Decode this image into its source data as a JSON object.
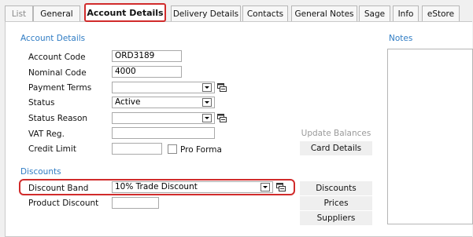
{
  "tabs": [
    "List",
    "General",
    "Account Details",
    "Delivery Details",
    "Contacts",
    "General Notes",
    "Sage",
    "Info",
    "eStore"
  ],
  "account_details": {
    "heading": "Account Details",
    "account_code_label": "Account Code",
    "account_code_value": "ORD3189",
    "nominal_code_label": "Nominal Code",
    "nominal_code_value": "4000",
    "payment_terms_label": "Payment Terms",
    "payment_terms_value": "",
    "status_label": "Status",
    "status_value": "Active",
    "status_reason_label": "Status Reason",
    "status_reason_value": "",
    "vat_label": "VAT Reg.",
    "vat_value": "",
    "credit_limit_label": "Credit Limit",
    "credit_limit_value": "",
    "pro_forma_label": "Pro Forma",
    "pro_forma_checked": false
  },
  "buttons": {
    "update_balances": "Update Balances",
    "card_details": "Card Details",
    "discounts": "Discounts",
    "prices": "Prices",
    "suppliers": "Suppliers"
  },
  "discounts": {
    "heading": "Discounts",
    "discount_band_label": "Discount Band",
    "discount_band_value": "10% Trade Discount",
    "product_discount_label": "Product Discount",
    "product_discount_value": ""
  },
  "notes": {
    "heading": "Notes"
  },
  "colors": {
    "section_heading": "#2f7cc4",
    "highlight": "#d12b2b"
  }
}
